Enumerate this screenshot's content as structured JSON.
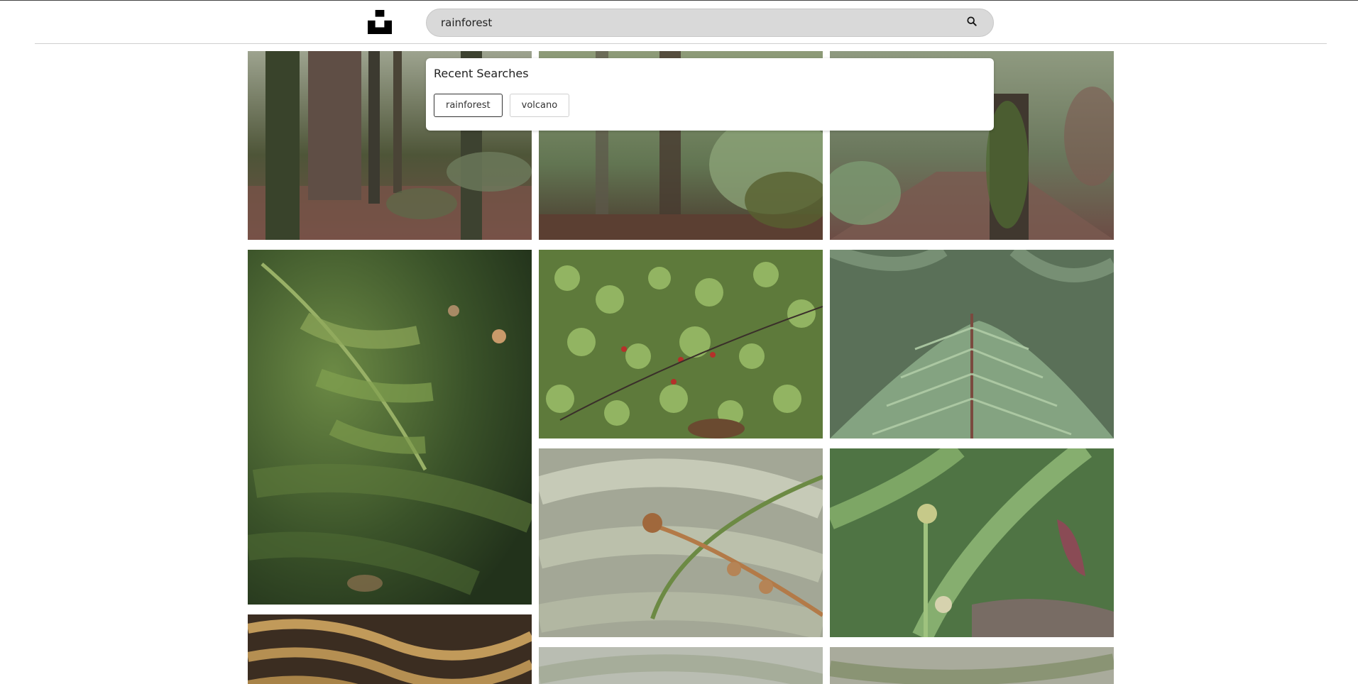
{
  "header": {
    "logo_icon": "unsplash-logo-icon",
    "search_value": "rainforest",
    "search_icon": "search-icon"
  },
  "recent_searches": {
    "title": "Recent Searches",
    "items": [
      "rainforest",
      "volcano"
    ]
  },
  "colors": {
    "search_bg": "#d9d9d9",
    "logo": "#000000"
  },
  "photos": [
    {
      "subject": "rainforest trail with mossy tree trunks"
    },
    {
      "subject": "forest floor with ferns and roots"
    },
    {
      "subject": "forest path with ivy covered stump"
    },
    {
      "subject": "green fern fronds in shade"
    },
    {
      "subject": "low green groundcover with red berries"
    },
    {
      "subject": "large tree fern frond"
    },
    {
      "subject": "unfurling fern fiddlehead"
    },
    {
      "subject": "fern koru and fronds"
    },
    {
      "subject": "dried brown fern fronds"
    },
    {
      "subject": "pale green fern foliage"
    },
    {
      "subject": "fern leaves close-up"
    }
  ]
}
